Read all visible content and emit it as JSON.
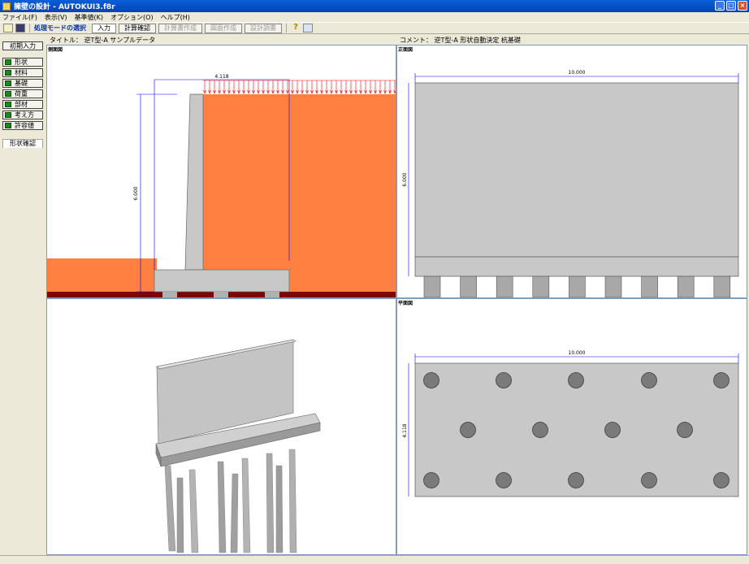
{
  "window": {
    "title": "擁壁の設計 - AUTOKUI3.f8r"
  },
  "menu": [
    "ファイル(F)",
    "表示(V)",
    "基準値(K)",
    "オプション(O)",
    "ヘルプ(H)"
  ],
  "toolbar": {
    "mode_label": "処理モードの選択",
    "buttons": [
      {
        "label": "入力",
        "state": "active"
      },
      {
        "label": "計算確認",
        "state": "normal"
      },
      {
        "label": "計算書作成",
        "state": "disabled"
      },
      {
        "label": "図面作成",
        "state": "disabled"
      },
      {
        "label": "設計調書",
        "state": "disabled"
      }
    ]
  },
  "info": {
    "title": "タイトル： 逆T型-A サンプルデータ",
    "comment": "コメント： 逆T型-A 形状自動決定 杭基礎"
  },
  "sidebar": {
    "initial_input": "初期入力",
    "items": [
      "形状",
      "材料",
      "基礎",
      "荷重",
      "部材",
      "考え方",
      "許容値"
    ],
    "tab": "形状確認"
  },
  "views": {
    "side": {
      "label": "側面図",
      "dim_top": "4.118",
      "dim_height": "6.000"
    },
    "front": {
      "label": "正面図",
      "dim_width": "10.000",
      "dim_height": "6.000"
    },
    "plan": {
      "label": "平面図",
      "dim_width": "10.000",
      "dim_depth": "4.118"
    }
  },
  "colors": {
    "soil": "#ff8040",
    "concrete": "#c8c8c8",
    "ground": "#800000",
    "dim_line": "#0000ff",
    "load": "#ff0000"
  }
}
